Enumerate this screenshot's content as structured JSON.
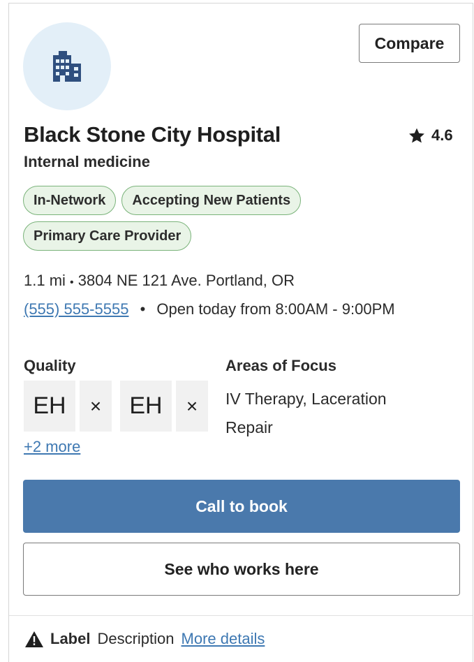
{
  "header": {
    "avatar_icon": "building-icon",
    "compare_label": "Compare"
  },
  "provider": {
    "name": "Black Stone City Hospital",
    "specialty": "Internal medicine",
    "rating_icon": "star-icon",
    "rating": "4.6"
  },
  "badges": [
    "In-Network",
    "Accepting New Patients",
    "Primary Care Provider"
  ],
  "location": {
    "distance": "1.1 mi",
    "separator": "•",
    "address": "3804 NE 121 Ave. Portland, OR"
  },
  "contact": {
    "phone": "(555) 555-5555",
    "separator": "•",
    "hours": "Open today from 8:00AM - 9:00PM"
  },
  "quality": {
    "label": "Quality",
    "tags": [
      {
        "text": "EH",
        "remove": "×"
      },
      {
        "text": "EH",
        "remove": "×"
      }
    ],
    "more_label": "+2 more"
  },
  "focus": {
    "label": "Areas of Focus",
    "text": "IV Therapy, Laceration Repair"
  },
  "actions": {
    "primary_label": "Call to book",
    "secondary_label": "See who works here"
  },
  "footer": {
    "icon": "warning-icon",
    "label": "Label",
    "description": "Description",
    "link": "More details"
  },
  "colors": {
    "accent": "#4a79ac",
    "link": "#3e78b2",
    "badge_bg": "#e9f4e7",
    "badge_border": "#7ab37a",
    "avatar_bg": "#e3eff8",
    "icon": "#2f4f7f"
  }
}
